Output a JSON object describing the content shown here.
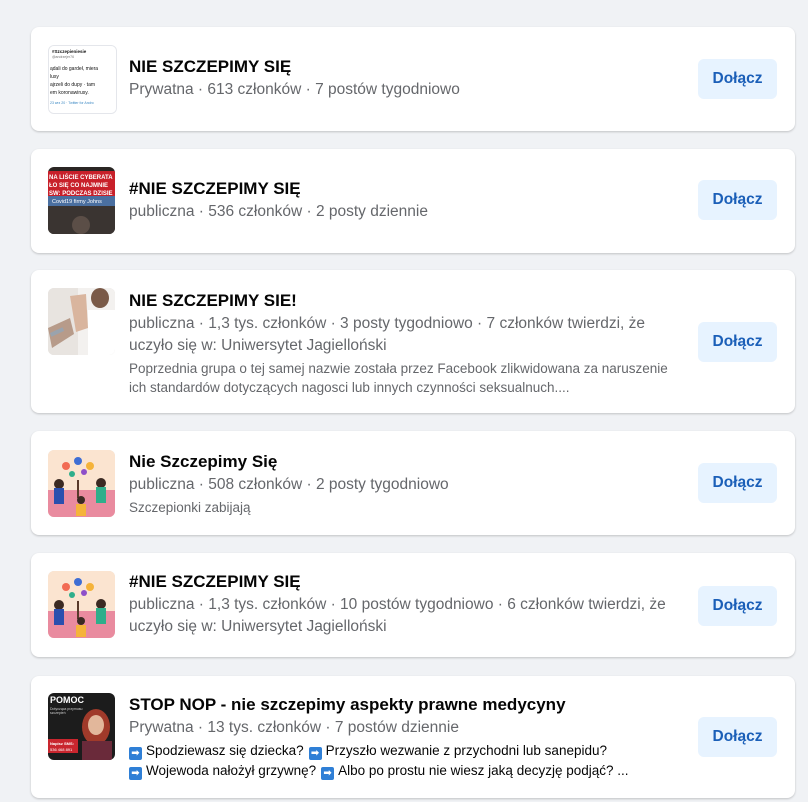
{
  "groups": [
    {
      "title": "NIE SZCZEPIMY SIĘ",
      "meta": "Prywatna · 613 członków · 7 postów tygodniowo",
      "join_label": "Dołącz",
      "thumb_icon": "tweet-screenshot-thumbnail",
      "thumb_text": [
        "#Szczepieniesie",
        "@andrzejer76",
        "ądali do gardeł, miera",
        "lusy",
        "ajrzeli do dupy · tam",
        "em koronawirusy.",
        "23 wrz 20 · Twitter for Andro"
      ]
    },
    {
      "title": "#NIE SZCZEPIMY SIĘ",
      "meta": "publiczna · 536 członków · 2 posty dziennie",
      "join_label": "Dołącz",
      "thumb_icon": "banner-photo-thumbnail",
      "thumb_text": [
        "NA LIŚCIE CYBERATA",
        "ŁO SIĘ CO NAJMNIE",
        "SW: PODCZAS DZISIE",
        "Covid19 firmy Johns"
      ]
    },
    {
      "title": "NIE SZCZEPIMY SIE!",
      "meta": "publiczna · 1,3 tys. członków · 3 posty tygodniowo · 7 członków twierdzi, że uczyło się w: Uniwersytet Jagielloński",
      "description": "Poprzednia grupa o tej samej nazwie została przez Facebook zlikwidowana za naruszenie ich standardów dotyczących nagosci lub innych czynności seksualnuch....",
      "join_label": "Dołącz",
      "thumb_icon": "person-refusing-injection-thumbnail"
    },
    {
      "title": "Nie Szczepimy Się",
      "meta": "publiczna · 508 członków · 2 posty tygodniowo",
      "description": "Szczepionki zabijają",
      "join_label": "Dołącz",
      "thumb_icon": "group-illustration-thumbnail"
    },
    {
      "title": "#NIE SZCZEPIMY SIĘ",
      "meta": "publiczna · 1,3 tys. członków · 10 postów tygodniowo · 6 członków twierdzi, że uczyło się w: Uniwersytet Jagielloński",
      "join_label": "Dołącz",
      "thumb_icon": "group-illustration-thumbnail"
    },
    {
      "title": "STOP NOP - nie szczepimy aspekty prawne medycyny",
      "meta": "Prywatna · 13 tys. członków · 7 postów dziennie",
      "desc_line1_a": "Spodziewasz się dziecka?",
      "desc_line1_b": "Przyszło wezwanie z przychodni lub sanepidu?",
      "desc_line2_a": "Wojewoda nałożył grzywnę?",
      "desc_line2_b": "Albo po prostu nie wiesz jaką decyzję podjąć? ...",
      "arrow_glyph": "➡",
      "join_label": "Dołącz",
      "thumb_icon": "pomoc-poster-thumbnail",
      "thumb_text": [
        "POMOC",
        "Dotycząca przymusu",
        "szczepień",
        "Napisz SMS:",
        "536 468 891"
      ]
    }
  ],
  "colors": {
    "page_bg": "#f0f2f5",
    "card_bg": "#ffffff",
    "title": "#050505",
    "meta": "#65676b",
    "button_bg": "#e7f3ff",
    "button_text": "#1b5fb8",
    "arrow_bg": "#2f7fd6"
  }
}
